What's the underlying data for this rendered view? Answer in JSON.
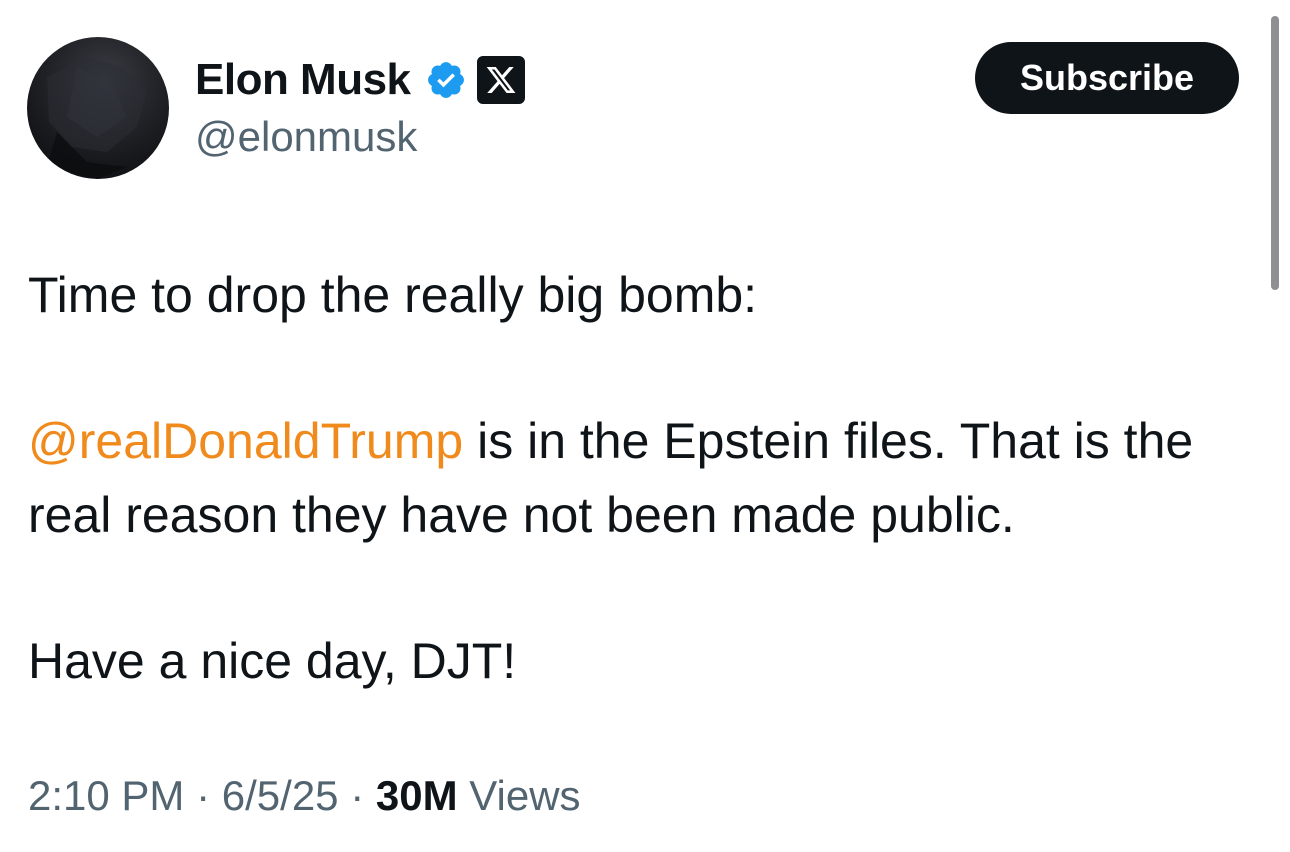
{
  "author": {
    "display_name": "Elon Musk",
    "handle": "@elonmusk",
    "verified_icon": "verified-badge-icon",
    "affiliation_icon": "x-logo-icon"
  },
  "header": {
    "subscribe_label": "Subscribe"
  },
  "tweet": {
    "line1": "Time to drop the really big bomb:",
    "mention": "@realDonaldTrump",
    "line2_rest": " is in the Epstein files. That is the real reason they have not been made public.",
    "line3": "Have a nice day, DJT!"
  },
  "meta": {
    "time": "2:10 PM",
    "separator": "·",
    "date": "6/5/25",
    "views_count": "30M",
    "views_label": "Views"
  },
  "colors": {
    "text": "#0f1419",
    "secondary": "#536471",
    "mention": "#f08a1c",
    "verified": "#1d9bf0",
    "button_bg": "#0f1419"
  }
}
